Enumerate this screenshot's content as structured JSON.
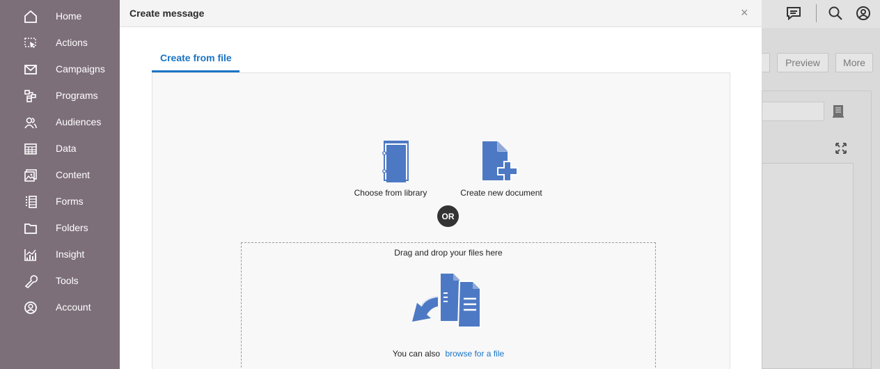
{
  "sidebar": {
    "items": [
      {
        "label": "Home",
        "icon": "home-icon"
      },
      {
        "label": "Actions",
        "icon": "actions-icon"
      },
      {
        "label": "Campaigns",
        "icon": "campaigns-icon"
      },
      {
        "label": "Programs",
        "icon": "programs-icon"
      },
      {
        "label": "Audiences",
        "icon": "audiences-icon"
      },
      {
        "label": "Data",
        "icon": "data-icon"
      },
      {
        "label": "Content",
        "icon": "content-icon"
      },
      {
        "label": "Forms",
        "icon": "forms-icon"
      },
      {
        "label": "Folders",
        "icon": "folders-icon"
      },
      {
        "label": "Insight",
        "icon": "insight-icon"
      },
      {
        "label": "Tools",
        "icon": "tools-icon"
      },
      {
        "label": "Account",
        "icon": "account-icon"
      }
    ]
  },
  "background": {
    "preview_label": "Preview",
    "more_label": "More"
  },
  "modal": {
    "title": "Create message",
    "close_label": "×",
    "tab_label": "Create from file",
    "library_label": "Choose from library",
    "new_doc_label": "Create new document",
    "or_label": "OR",
    "drop_text": "Drag and drop your files here",
    "also_text": "You can also",
    "browse_label": "browse for a file"
  },
  "colors": {
    "sidebar_bg": "#7d6f7a",
    "accent": "#1a74c4",
    "icon_blue": "#4d79c4"
  }
}
